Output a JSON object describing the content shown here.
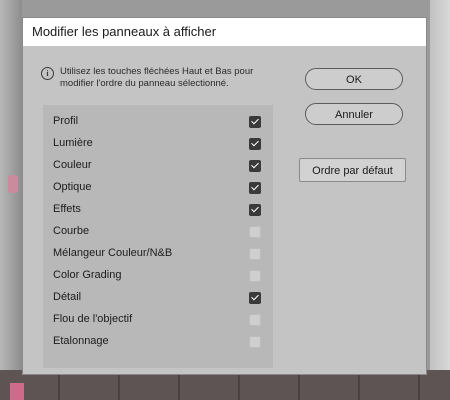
{
  "dialog": {
    "title": "Modifier les panneaux à afficher",
    "info_icon": "info-icon",
    "info_text": "Utilisez les touches fléchées Haut et Bas pour modifier l'ordre du panneau sélectionné."
  },
  "panels": [
    {
      "label": "Profil",
      "checked": true
    },
    {
      "label": "Lumière",
      "checked": true
    },
    {
      "label": "Couleur",
      "checked": true
    },
    {
      "label": "Optique",
      "checked": true
    },
    {
      "label": "Effets",
      "checked": true
    },
    {
      "label": "Courbe",
      "checked": false
    },
    {
      "label": "Mélangeur Couleur/N&B",
      "checked": false
    },
    {
      "label": "Color Grading",
      "checked": false
    },
    {
      "label": "Détail",
      "checked": true
    },
    {
      "label": "Flou de l'objectif",
      "checked": false
    },
    {
      "label": "Etalonnage",
      "checked": false
    }
  ],
  "buttons": {
    "ok": "OK",
    "cancel": "Annuler",
    "default_order": "Ordre par défaut"
  }
}
